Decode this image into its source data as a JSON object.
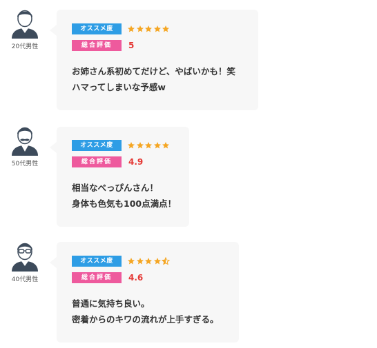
{
  "colors": {
    "recommend_tag": "#2e9de5",
    "rating_tag": "#ee5a9d",
    "star": "#f5a623",
    "score": "#e53935",
    "bubble": "#f7f7f7"
  },
  "reviews": [
    {
      "age": "20代男性",
      "avatar_icon": "young-man-avatar-icon",
      "recommend_label": "オススメ度",
      "stars": 5,
      "rating_label": "総合評価",
      "score": "5",
      "comment_lines": [
        "お姉さん系初めてだけど、やばいかも！笑",
        "ハマってしまいな予感w"
      ]
    },
    {
      "age": "50代男性",
      "avatar_icon": "mustache-man-avatar-icon",
      "recommend_label": "オススメ度",
      "stars": 5,
      "rating_label": "総合評価",
      "score": "4.9",
      "comment_lines": [
        "相当なべっぴんさん！",
        "身体も色気も100点満点！"
      ]
    },
    {
      "age": "40代男性",
      "avatar_icon": "glasses-man-avatar-icon",
      "recommend_label": "オススメ度",
      "stars": 4.5,
      "rating_label": "総合評価",
      "score": "4.6",
      "comment_lines": [
        "普通に気持ち良い。",
        "密着からのキワの流れが上手すぎる。"
      ]
    }
  ]
}
